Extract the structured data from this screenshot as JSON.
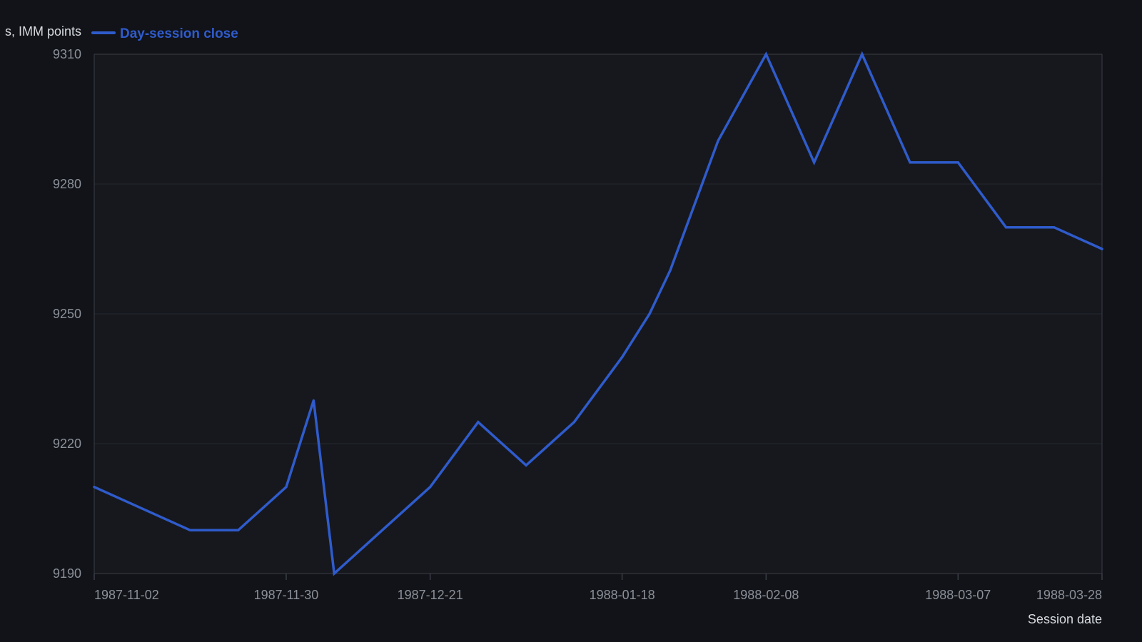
{
  "chart_data": {
    "type": "line",
    "title": "",
    "xlabel": "Session date",
    "ylabel": "s, IMM points",
    "x_ticks": [
      "1987-11-02",
      "1987-11-30",
      "1987-12-21",
      "1988-01-18",
      "1988-02-08",
      "1988-03-07",
      "1988-03-28"
    ],
    "y_ticks": [
      9190,
      9220,
      9250,
      9280,
      9310
    ],
    "xlim": [
      "1987-11-02",
      "1988-03-28"
    ],
    "ylim": [
      9190,
      9310
    ],
    "grid": true,
    "legend_position": "top-left",
    "series": [
      {
        "name": "Day-session close",
        "color": "#2f5bcc",
        "points": [
          [
            "1987-11-02",
            9210
          ],
          [
            "1987-11-16",
            9200
          ],
          [
            "1987-11-23",
            9200
          ],
          [
            "1987-11-30",
            9210
          ],
          [
            "1987-12-04",
            9230
          ],
          [
            "1987-12-07",
            9190
          ],
          [
            "1987-12-21",
            9210
          ],
          [
            "1987-12-28",
            9225
          ],
          [
            "1988-01-04",
            9215
          ],
          [
            "1988-01-11",
            9225
          ],
          [
            "1988-01-18",
            9240
          ],
          [
            "1988-01-22",
            9250
          ],
          [
            "1988-01-25",
            9260
          ],
          [
            "1988-02-01",
            9290
          ],
          [
            "1988-02-08",
            9310
          ],
          [
            "1988-02-15",
            9285
          ],
          [
            "1988-02-22",
            9310
          ],
          [
            "1988-02-29",
            9285
          ],
          [
            "1988-03-07",
            9285
          ],
          [
            "1988-03-14",
            9270
          ],
          [
            "1988-03-21",
            9270
          ],
          [
            "1988-03-28",
            9265
          ]
        ]
      }
    ]
  },
  "colors": {
    "background": "#111318",
    "plot_background": "#16181d",
    "grid": "#24272e",
    "axis": "#3a3e46",
    "tick_text": "#8b9099",
    "axis_title_text": "#d7dae0",
    "series": "#2f5bcc"
  }
}
